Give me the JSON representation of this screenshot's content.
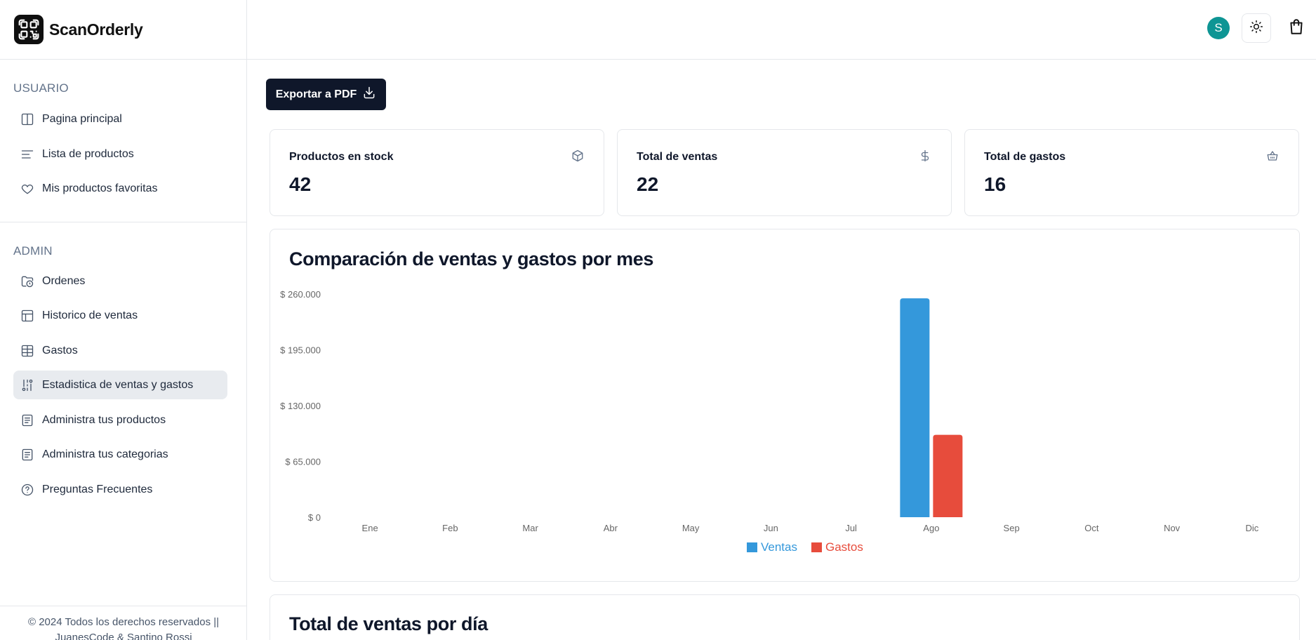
{
  "brand": {
    "name": "ScanOrderly"
  },
  "sidebar": {
    "usuario_title": "USUARIO",
    "usuario_items": [
      {
        "label": "Pagina principal",
        "icon": "book-icon"
      },
      {
        "label": "Lista de productos",
        "icon": "list-icon"
      },
      {
        "label": "Mis productos favoritas",
        "icon": "heart-icon"
      }
    ],
    "admin_title": "ADMIN",
    "admin_items": [
      {
        "label": "Ordenes",
        "icon": "folder-clock-icon"
      },
      {
        "label": "Historico de ventas",
        "icon": "table-icon"
      },
      {
        "label": "Gastos",
        "icon": "grid-icon"
      },
      {
        "label": "Estadistica de ventas y gastos",
        "icon": "route-icon",
        "active": true
      },
      {
        "label": "Administra tus productos",
        "icon": "file-list-icon"
      },
      {
        "label": "Administra tus categorias",
        "icon": "file-list-icon"
      },
      {
        "label": "Preguntas Frecuentes",
        "icon": "help-circle-icon"
      }
    ],
    "footer_line1": "© 2024 Todos los derechos reservados ||",
    "footer_line2": "JuanesCode & Santino Rossi"
  },
  "header": {
    "avatar_letter": "S"
  },
  "export_button": {
    "label": "Exportar a PDF"
  },
  "stats": [
    {
      "title": "Productos en stock",
      "value": "42",
      "icon": "box-icon"
    },
    {
      "title": "Total de ventas",
      "value": "22",
      "icon": "dollar-icon"
    },
    {
      "title": "Total de gastos",
      "value": "16",
      "icon": "basket-icon"
    }
  ],
  "chart_title": "Comparación de ventas y gastos por mes",
  "chart_data": {
    "type": "bar",
    "categories": [
      "Ene",
      "Feb",
      "Mar",
      "Abr",
      "May",
      "Jun",
      "Jul",
      "Ago",
      "Sep",
      "Oct",
      "Nov",
      "Dic"
    ],
    "series": [
      {
        "name": "Ventas",
        "color": "#3498db",
        "values": [
          0,
          0,
          0,
          0,
          0,
          0,
          0,
          255000,
          0,
          0,
          0,
          0
        ]
      },
      {
        "name": "Gastos",
        "color": "#e74c3c",
        "values": [
          0,
          0,
          0,
          0,
          0,
          0,
          0,
          96000,
          0,
          0,
          0,
          0
        ]
      }
    ],
    "ylim": [
      0,
      260000
    ],
    "yticks": [
      "$ 0",
      "$ 65.000",
      "$ 130.000",
      "$ 195.000",
      "$ 260.000"
    ],
    "ytick_values": [
      0,
      65000,
      130000,
      195000,
      260000
    ],
    "legend": "bottom-center",
    "grid": false
  },
  "bottom_chart_title": "Total de ventas por día"
}
